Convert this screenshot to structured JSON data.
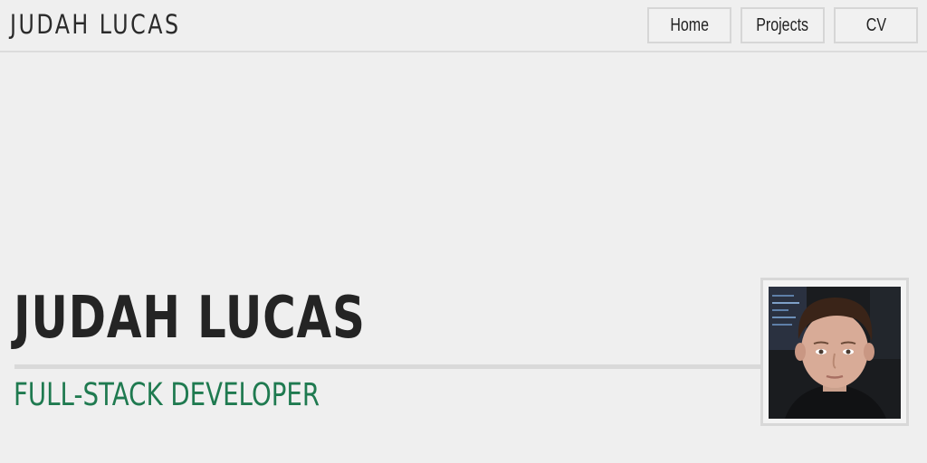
{
  "header": {
    "brand": "JUDAH LUCAS",
    "nav": [
      {
        "label": "Home"
      },
      {
        "label": "Projects"
      },
      {
        "label": "CV"
      }
    ]
  },
  "hero": {
    "name": "JUDAH LUCAS",
    "role": "FULL-STACK DEVELOPER",
    "photo_icon": "profile-photo",
    "accent_color": "#1f7a50"
  }
}
